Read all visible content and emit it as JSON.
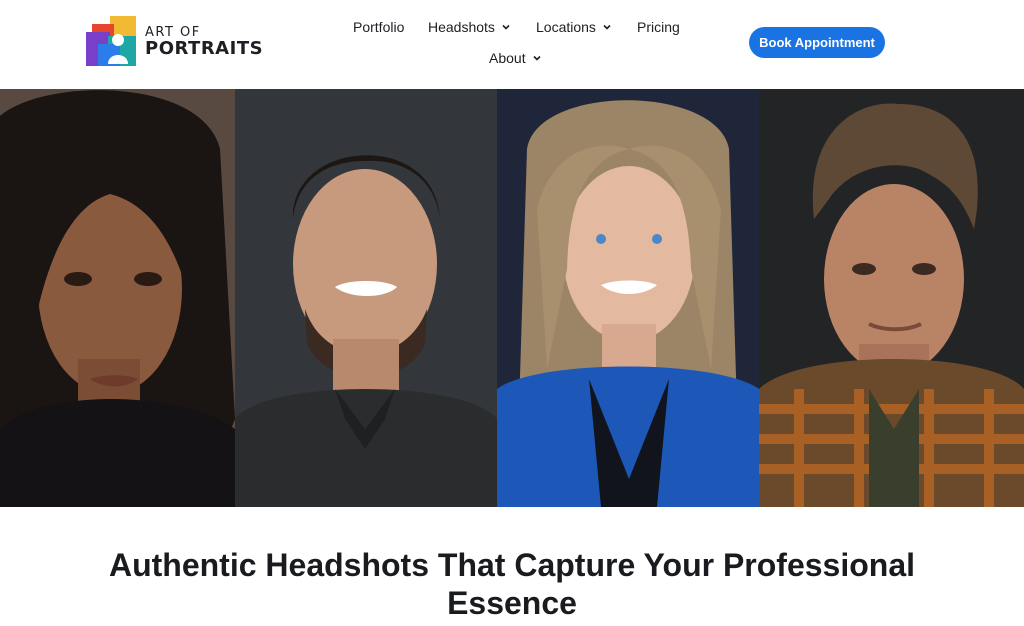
{
  "brand": {
    "logo_line1": "ART OF",
    "logo_line2": "PORTRAITS",
    "colors": [
      "#f2b933",
      "#2b7de9",
      "#7a3fc8",
      "#1ea7a4"
    ]
  },
  "nav": {
    "portfolio": "Portfolio",
    "headshots": "Headshots",
    "locations": "Locations",
    "pricing": "Pricing",
    "about": "About"
  },
  "cta": {
    "book_label": "Book Appointment",
    "color": "#1a73e3"
  },
  "hero": {
    "portraits": [
      {
        "icon": "portrait-woman-dark-hair"
      },
      {
        "icon": "portrait-man-dark-polo"
      },
      {
        "icon": "portrait-woman-blonde-blue-blazer"
      },
      {
        "icon": "portrait-man-plaid-shirt"
      }
    ]
  },
  "main": {
    "headline": "Authentic Headshots That Capture Your Professional Essence"
  }
}
